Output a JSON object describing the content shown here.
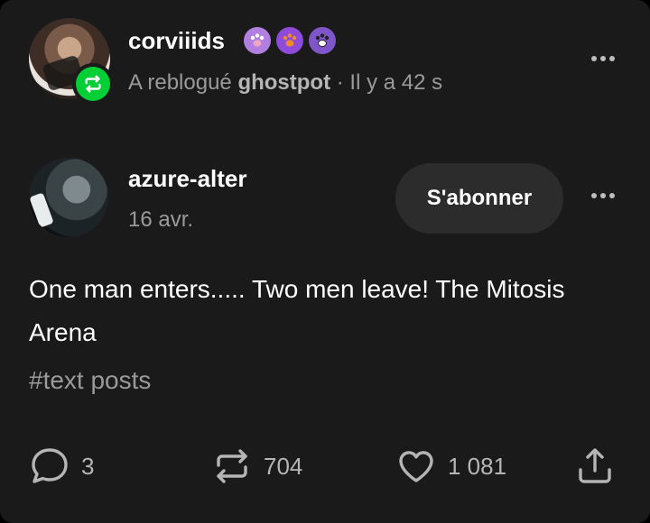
{
  "reblog": {
    "username": "corviiids",
    "badges": [
      "paw-print-badge",
      "paw-print-badge",
      "paw-print-badge"
    ],
    "action_text": "A reblogué",
    "source": "ghostpot",
    "separator": "·",
    "time": "Il y a 42 s"
  },
  "post": {
    "author": "azure-alter",
    "date": "16 avr.",
    "follow_label": "S'abonner",
    "body": "One man enters..... Two men leave! The Mitosis Arena",
    "tags": "#text posts"
  },
  "actions": {
    "replies": "3",
    "reblogs": "704",
    "likes": "1 081"
  },
  "colors": {
    "background": "#1a1a1a",
    "reblog_green": "#00cf35",
    "muted_text": "#9a9a9a",
    "button_bg": "#2c2c2c"
  }
}
